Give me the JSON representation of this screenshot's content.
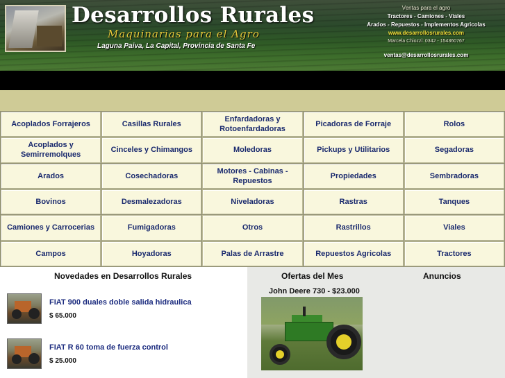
{
  "header": {
    "title": "Desarrollos Rurales",
    "tagline": "Maquinarias para el Agro",
    "location": "Laguna Paiva, La Capital, Provincia de Santa Fe",
    "contact": {
      "sales": "Ventas para el agro",
      "line1": "Tractores - Camiones - Viales",
      "line2": "Arados - Repuestos - Implementos Agricolas",
      "website": "www.desarrollosrurales.com",
      "person": "Marcela Chiozzi: 0342 - 154360767",
      "email": "ventas@desarrollosrurales.com"
    }
  },
  "categories": [
    "Acoplados Forrajeros",
    "Casillas Rurales",
    "Enfardadoras y Rotoenfardadoras",
    "Picadoras de Forraje",
    "Rolos",
    "Acoplados y Semirremolques",
    "Cinceles y Chimangos",
    "Moledoras",
    "Pickups y Utilitarios",
    "Segadoras",
    "Arados",
    "Cosechadoras",
    "Motores - Cabinas - Repuestos",
    "Propiedades",
    "Sembradoras",
    "Bovinos",
    "Desmalezadoras",
    "Niveladoras",
    "Rastras",
    "Tanques",
    "Camiones y Carrocerias",
    "Fumigadoras",
    "Otros",
    "Rastrillos",
    "Viales",
    "Campos",
    "Hoyadoras",
    "Palas de Arrastre",
    "Repuestos Agricolas",
    "Tractores"
  ],
  "news": {
    "heading": "Novedades en Desarrollos Rurales",
    "items": [
      {
        "title": "FIAT 900 duales doble salida hidraulica",
        "price": "$ 65.000"
      },
      {
        "title": "FIAT R 60 toma de fuerza control",
        "price": "$ 25.000"
      }
    ]
  },
  "offers": {
    "heading": "Ofertas del Mes",
    "item_title": "John Deere 730 - $23.000"
  },
  "ads": {
    "heading": "Anuncios"
  },
  "colors": {
    "link": "#1a2a6e",
    "cell_bg": "#f9f7dd",
    "tan_bar": "#cfcb96",
    "offers_bg": "#e8e9e6",
    "website_yellow": "#f2e13a"
  }
}
